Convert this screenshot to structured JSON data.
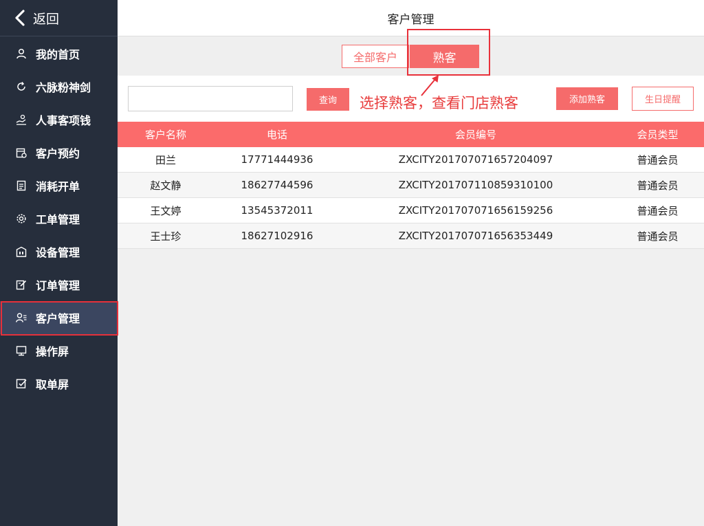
{
  "sidebar": {
    "back_label": "返回",
    "items": [
      {
        "label": "我的首页",
        "icon": "user-icon"
      },
      {
        "label": "六脉粉神剑",
        "icon": "refresh-icon"
      },
      {
        "label": "人事客项钱",
        "icon": "hand-money-icon"
      },
      {
        "label": "客户预约",
        "icon": "calendar-icon"
      },
      {
        "label": "消耗开单",
        "icon": "document-icon"
      },
      {
        "label": "工单管理",
        "icon": "gear-icon"
      },
      {
        "label": "设备管理",
        "icon": "building-icon"
      },
      {
        "label": "订单管理",
        "icon": "edit-icon"
      },
      {
        "label": "客户管理",
        "icon": "user-list-icon"
      },
      {
        "label": "操作屏",
        "icon": "monitor-icon"
      },
      {
        "label": "取单屏",
        "icon": "checkbox-icon"
      }
    ],
    "active_index": 8
  },
  "header": {
    "title": "客户管理"
  },
  "tabs": {
    "all_label": "全部客户",
    "shuke_label": "熟客",
    "selected": "熟客"
  },
  "toolbar": {
    "search_placeholder": "",
    "query_label": "查询",
    "annotation": "选择熟客，查看门店熟客",
    "add_label": "添加熟客",
    "birthday_label": "生日提醒"
  },
  "table": {
    "headers": [
      "客户名称",
      "电话",
      "会员编号",
      "会员类型"
    ],
    "rows": [
      [
        "田兰",
        "17771444936",
        "ZXCITY201707071657204097",
        "普通会员"
      ],
      [
        "赵文静",
        "18627744596",
        "ZXCITY201707110859310100",
        "普通会员"
      ],
      [
        "王文婷",
        "13545372011",
        "ZXCITY201707071656159256",
        "普通会员"
      ],
      [
        "王士珍",
        "18627102916",
        "ZXCITY201707071656353449",
        "普通会员"
      ]
    ]
  },
  "colors": {
    "sidebar_bg": "#262e3c",
    "accent": "#f56b6b",
    "table_header": "#fb6b6b",
    "highlight": "#e8303a"
  }
}
